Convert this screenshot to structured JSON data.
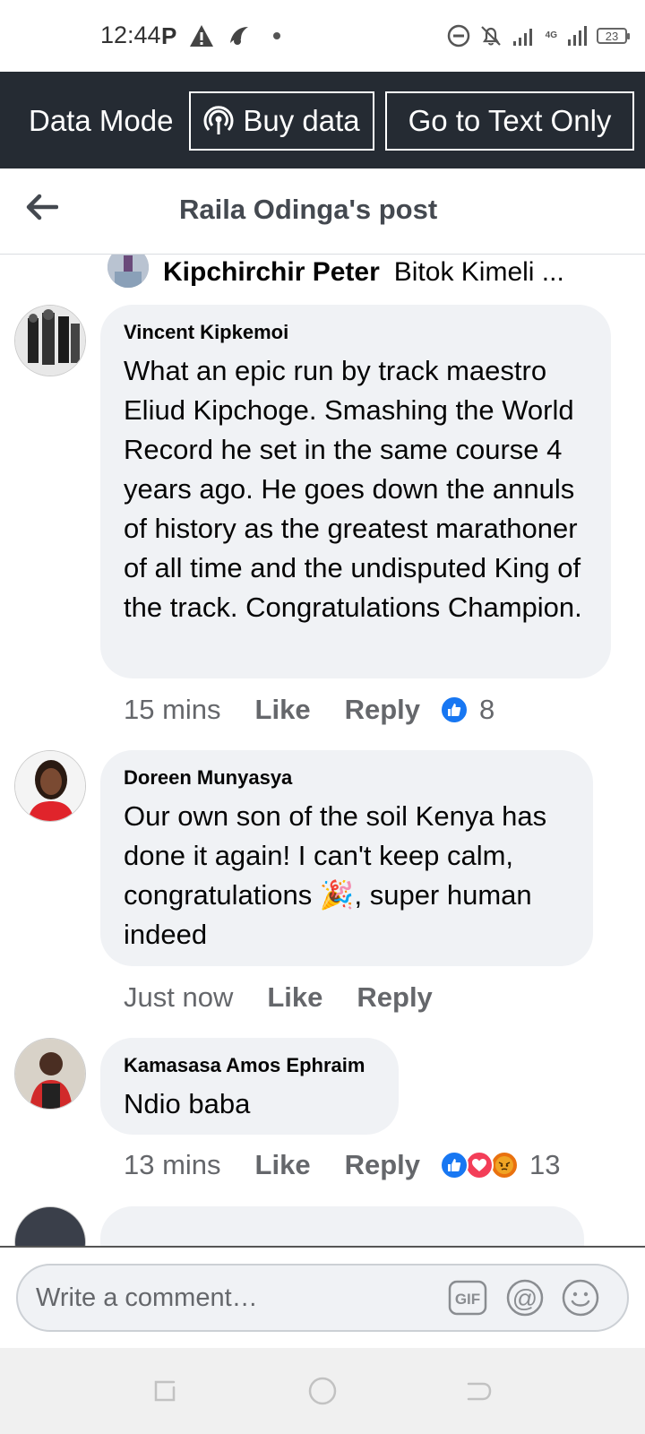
{
  "status_bar": {
    "time": "12:44",
    "p_icon": "P",
    "network_label": "4G",
    "battery": "23"
  },
  "data_bar": {
    "mode_label": "Data Mode",
    "buy_label": "Buy data",
    "text_only_label": "Go to Text Only"
  },
  "header": {
    "title": "Raila Odinga's post"
  },
  "partial_comment": {
    "name": "Kipchirchir Peter",
    "rest": "Bitok Kimeli ..."
  },
  "comments": [
    {
      "name": "Vincent Kipkemoi",
      "text": "What an epic run by track maestro Eliud Kipchoge. Smashing the World Record he set in the same course 4 years ago. He goes down the annuls of history as the greatest marathoner of all time and the undisputed King of the track. Congratulations Champion.",
      "time": "15 mins",
      "like": "Like",
      "reply": "Reply",
      "reaction_count": "8"
    },
    {
      "name": "Doreen Munyasya",
      "text_before": "Our own son of the soil Kenya has done it again! I can't keep calm, congratulations ",
      "text_after": ", super human indeed",
      "emoji": "🎉",
      "time": "Just now",
      "like": "Like",
      "reply": "Reply"
    },
    {
      "name": "Kamasasa Amos Ephraim",
      "text": "Ndio baba",
      "time": "13 mins",
      "like": "Like",
      "reply": "Reply",
      "reaction_count": "13"
    }
  ],
  "composer": {
    "placeholder": "Write a comment…",
    "gif_label": "GIF",
    "mention_label": "@"
  },
  "colors": {
    "data_bar_bg": "#252b33",
    "bubble_bg": "#f0f2f5",
    "like_blue": "#1877f2",
    "love_red": "#f33e58",
    "angry_orange": "#e9710f"
  }
}
